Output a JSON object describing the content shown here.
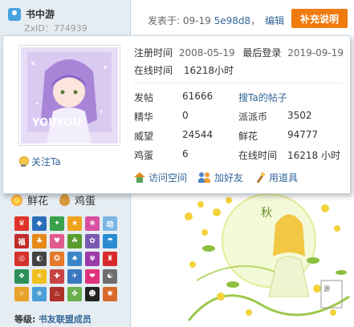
{
  "user": {
    "name": "书中游",
    "zxid": "ZxID：774939"
  },
  "post_header": {
    "posted_prefix": "发表于: ",
    "date": "09-19",
    "hash": "5e98d8",
    "sep": "，",
    "edit_label": "编辑",
    "supplement_button": "补充说明"
  },
  "popup": {
    "reg_label": "注册时间",
    "reg_value": "2008-05-19",
    "last_login_label": "最后登录",
    "last_login_value": "2019-09-19",
    "online_label": "在线时间",
    "online_value": "16218小时",
    "follow_label": "关注Ta",
    "avatar_caption": "YOUYOU",
    "stats": {
      "posts_label": "发帖",
      "posts_value": "61666",
      "search_posts_link": "搜Ta的帖子",
      "digest_label": "精华",
      "digest_value": "0",
      "coins_label": "派派币",
      "coins_value": "3502",
      "prestige_label": "威望",
      "prestige_value": "24544",
      "flowers_label": "鲜花",
      "flowers_value": "94777",
      "eggs_label": "鸡蛋",
      "eggs_value": "6",
      "online2_label": "在线时间",
      "online2_value": "16218 小时"
    },
    "actions": {
      "visit_space": "访问空间",
      "add_friend": "加好友",
      "use_item": "用道具"
    }
  },
  "gifts": {
    "flower_label": "鲜花",
    "egg_label": "鸡蛋"
  },
  "level": {
    "label": "等级:",
    "value": "书友联盟成员"
  },
  "medals": [
    {
      "color": "#e0342a",
      "text": "♛"
    },
    {
      "color": "#2c6fb9",
      "text": "◆"
    },
    {
      "color": "#3aa04b",
      "text": "✦"
    },
    {
      "color": "#f0a21e",
      "text": "★"
    },
    {
      "color": "#d94fa0",
      "text": "❀"
    },
    {
      "color": "#7bb6e4",
      "text": "动"
    },
    {
      "color": "#c02c2c",
      "text": "福"
    },
    {
      "color": "#e58a1a",
      "text": "♣"
    },
    {
      "color": "#e05b8b",
      "text": "♥"
    },
    {
      "color": "#5a9c2e",
      "text": "☘"
    },
    {
      "color": "#7a5ab0",
      "text": "✿"
    },
    {
      "color": "#2a8bd0",
      "text": "☂"
    },
    {
      "color": "#d6312b",
      "text": "◎"
    },
    {
      "color": "#444444",
      "text": "◐"
    },
    {
      "color": "#e47b2b",
      "text": "✪"
    },
    {
      "color": "#3a86c8",
      "text": "♠"
    },
    {
      "color": "#9b3aa8",
      "text": "✾"
    },
    {
      "color": "#d82a2a",
      "text": "♜"
    },
    {
      "color": "#2e8f5a",
      "text": "❖"
    },
    {
      "color": "#f0c020",
      "text": "☀"
    },
    {
      "color": "#c94444",
      "text": "✚"
    },
    {
      "color": "#3a78c0",
      "text": "✈"
    },
    {
      "color": "#e0347a",
      "text": "❤"
    },
    {
      "color": "#6e6e6e",
      "text": "☯"
    },
    {
      "color": "#e8a32a",
      "text": "✧"
    },
    {
      "color": "#4a9fd8",
      "text": "❄"
    },
    {
      "color": "#b0302c",
      "text": "♨"
    },
    {
      "color": "#6ab04c",
      "text": "✤"
    },
    {
      "color": "#222222",
      "text": "☻"
    },
    {
      "color": "#d96a2a",
      "text": "✺"
    }
  ]
}
